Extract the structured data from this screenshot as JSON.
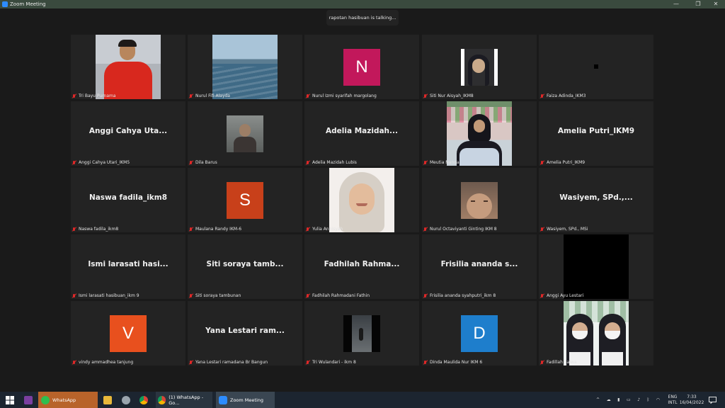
{
  "window": {
    "title": "Zoom Meeting"
  },
  "talking_indicator": "rapotan hasibuan is talking...",
  "participants": [
    {
      "name": "Tri Bayu Purnama",
      "type": "video",
      "video": "person-red-shirt"
    },
    {
      "name": "Nurul Fifi Alayda",
      "type": "video",
      "video": "sea-view"
    },
    {
      "name": "Nurul Izmi syarifah margolang",
      "type": "letter",
      "letter": "N",
      "color": "#c2185b"
    },
    {
      "name": "Siti Nur Aisyah_IKM8",
      "type": "video",
      "video": "hijab-portrait"
    },
    {
      "name": "Faiza Adinda_IKM3",
      "type": "video",
      "video": "black-dot"
    },
    {
      "name": "Anggi Cahya Utari_IKM5",
      "type": "text",
      "display": "Anggi Cahya Uta..."
    },
    {
      "name": "Dila Barus",
      "type": "video",
      "video": "small-portrait"
    },
    {
      "name": "Adelia Mazidah Lubis",
      "type": "text",
      "display": "Adelia  Mazidah..."
    },
    {
      "name": "Meutia Nanda",
      "type": "video",
      "video": "hijab-flowers"
    },
    {
      "name": "Amelia Putri_IKM9",
      "type": "text",
      "display": "Amelia Putri_IKM9"
    },
    {
      "name": "Naswa fadila_ikm8",
      "type": "text",
      "display": "Naswa fadila_ikm8"
    },
    {
      "name": "Maulana Randy IKM-6",
      "type": "letter",
      "letter": "S",
      "color": "#c8401a"
    },
    {
      "name": "Yulia Annisyah",
      "type": "video",
      "video": "hijab-smile"
    },
    {
      "name": "Nurul Octaviyanti Ginting IKM 8",
      "type": "video",
      "video": "face-closeup"
    },
    {
      "name": "Wasiyem, SPd., MSi",
      "type": "text",
      "display": "Wasiyem,  SPd.,..."
    },
    {
      "name": "Ismi larasati hasibuan_ikm 9",
      "type": "text",
      "display": "Ismi larasati hasi..."
    },
    {
      "name": "Siti soraya tambunan",
      "type": "text",
      "display": "Siti soraya tamb..."
    },
    {
      "name": "Fadhilah Rahmadani Fathin",
      "type": "text",
      "display": "Fadhilah  Rahma..."
    },
    {
      "name": "Frisilia ananda syahputri_ikm 8",
      "type": "text",
      "display": "Frisilia ananda s..."
    },
    {
      "name": "Anggi Ayu Lestari",
      "type": "video",
      "video": "black"
    },
    {
      "name": "vindy ammadhea tanjung",
      "type": "letter",
      "letter": "V",
      "color": "#e8501e"
    },
    {
      "name": "Yana Lestari ramadana Br Bangun",
      "type": "text",
      "display": "Yana Lestari ram..."
    },
    {
      "name": "Tri Wulandari - ikm 8",
      "type": "video",
      "video": "dark-road"
    },
    {
      "name": "Dinda Maulida Nur IKM 6",
      "type": "letter",
      "letter": "D",
      "color": "#1e7ecc"
    },
    {
      "name": "Fadillah Salwa",
      "type": "video",
      "video": "two-masks"
    }
  ],
  "taskbar": {
    "whatsapp_label": "WhatsApp",
    "chrome_tab_label": "(1) WhatsApp - Go...",
    "zoom_label": "Zoom Meeting",
    "lang1": "ENG",
    "lang2": "INTL",
    "time": "7:33",
    "date": "16/04/2022"
  }
}
